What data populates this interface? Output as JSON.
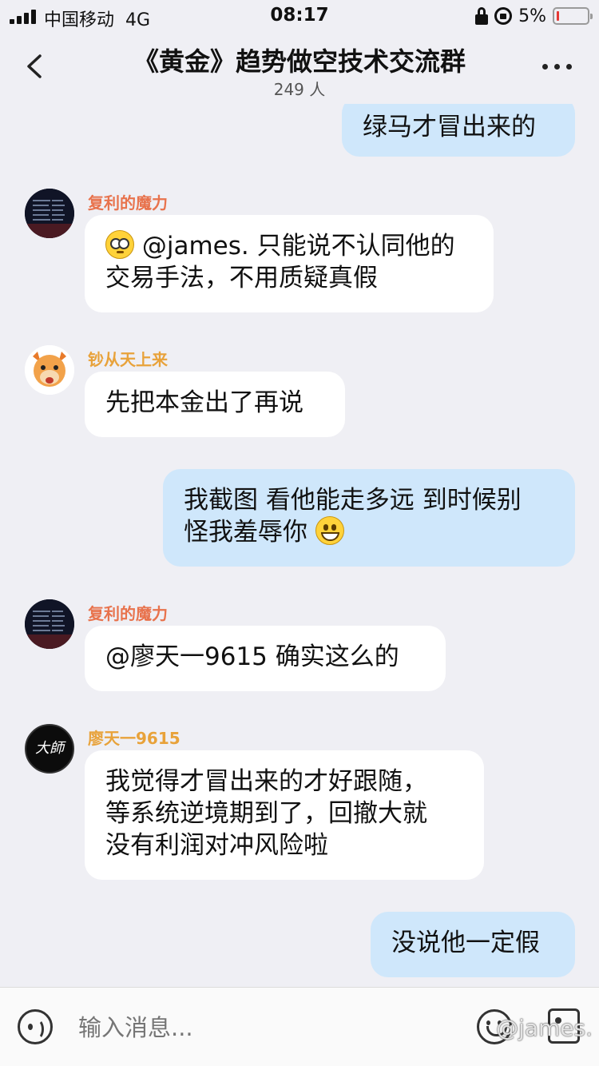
{
  "status_bar": {
    "carrier": "中国移动",
    "network": "4G",
    "time": "08:17",
    "battery_percent": "5%",
    "battery_color": "#e53935"
  },
  "header": {
    "title": "《黄金》趋势做空技术交流群",
    "member_count": "249 人",
    "back_icon": "chevron-left-icon",
    "more_icon": "ellipsis-icon"
  },
  "messages": [
    {
      "from": "self",
      "text": "绿马才冒出来的"
    },
    {
      "from": "other",
      "sender": "复利的魔力",
      "sender_color": "#e8734d",
      "emoji": "flushed",
      "text": "@james. 只能说不认同他的\n交易手法，不用质疑真假"
    },
    {
      "from": "other",
      "sender": "钞从天上来",
      "sender_color": "#e8a23a",
      "text": "先把本金出了再说"
    },
    {
      "from": "self",
      "line1": "我截图 看他能走多远 到时候别",
      "line2": "怪我羞辱你",
      "emoji": "grin"
    },
    {
      "from": "other",
      "sender": "复利的魔力",
      "sender_color": "#e8734d",
      "text": "@廖天一9615 确实这么的"
    },
    {
      "from": "other",
      "sender": "廖天一9615",
      "sender_color": "#e8a23a",
      "avatar_text": "大師",
      "text": "我觉得才冒出来的才好跟随，\n等系统逆境期到了，回撤大就\n没有利润对冲风险啦"
    },
    {
      "from": "self",
      "text": "没说他一定假"
    }
  ],
  "input_bar": {
    "placeholder": "输入消息...",
    "voice_icon": "voice-icon",
    "emoji_icon": "emoji-icon",
    "image_icon": "image-icon",
    "watermark": "@james."
  },
  "colors": {
    "self_bubble": "#cfe7fb",
    "other_bubble": "#ffffff",
    "background": "#efeff4"
  }
}
